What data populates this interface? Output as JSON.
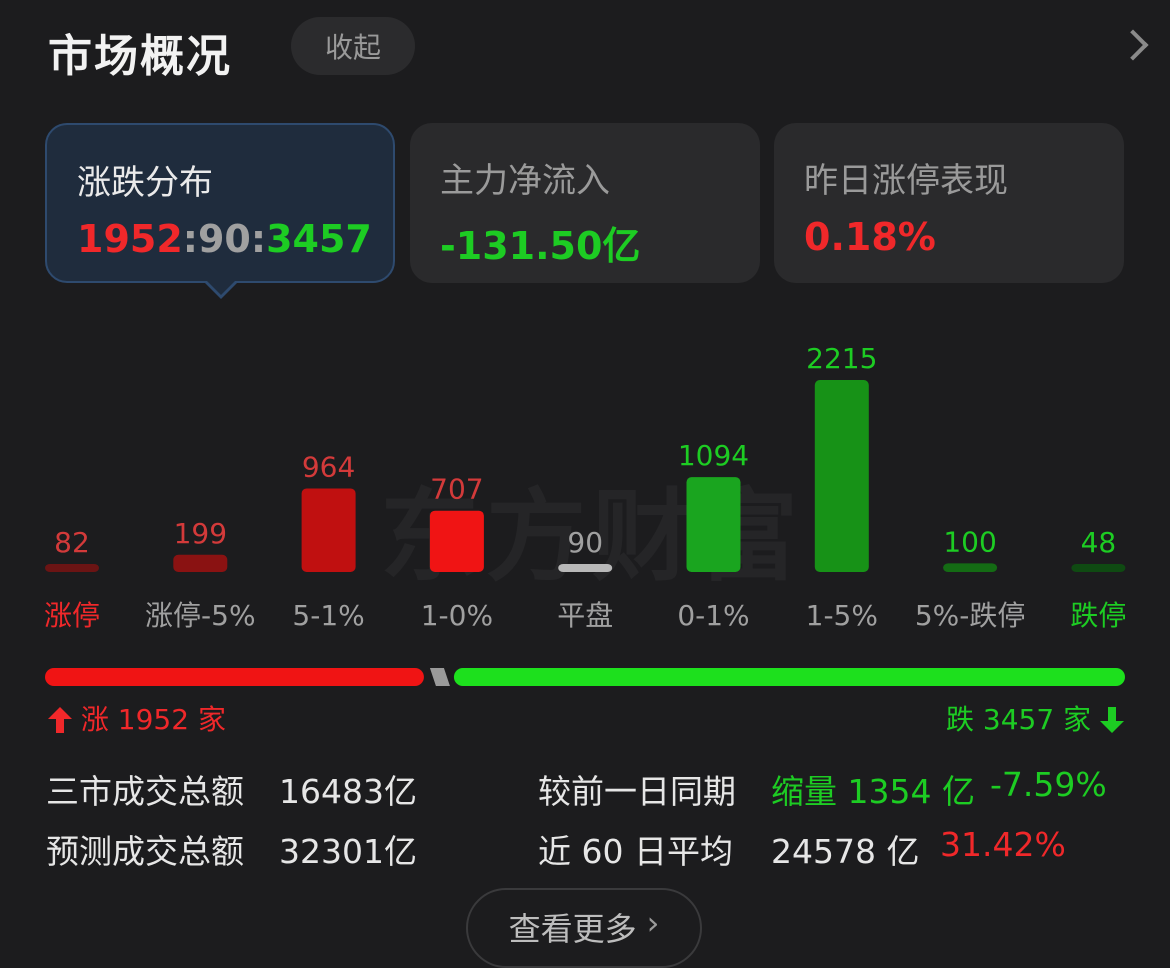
{
  "header": {
    "title": "市场概况",
    "collapse_label": "收起"
  },
  "cards": [
    {
      "label": "涨跌分布",
      "up": "1952",
      "flat": "90",
      "down": "3457"
    },
    {
      "label": "主力净流入",
      "value": "-131.50亿"
    },
    {
      "label": "昨日涨停表现",
      "value": "0.18%"
    }
  ],
  "watermark": "东方财富",
  "chart_data": {
    "type": "bar",
    "categories": [
      "涨停",
      "涨停-5%",
      "5-1%",
      "1-0%",
      "平盘",
      "0-1%",
      "1-5%",
      "5%-跌停",
      "跌停"
    ],
    "values": [
      82,
      199,
      964,
      707,
      90,
      1094,
      2215,
      100,
      48
    ],
    "colors": [
      "#6b1414",
      "#8a1212",
      "#c01010",
      "#f01414",
      "#b8b8b8",
      "#1aa51f",
      "#179217",
      "#146b14",
      "#0f4a12"
    ],
    "label_colors": [
      "#d33a3a",
      "#d33a3a",
      "#d33a3a",
      "#d33a3a",
      "#a0a0a0",
      "#1dcc23",
      "#1dcc23",
      "#1dcc23",
      "#1dcc23"
    ],
    "category_colors": [
      "#f0282a",
      "#a0a0a0",
      "#a0a0a0",
      "#a0a0a0",
      "#a0a0a0",
      "#a0a0a0",
      "#a0a0a0",
      "#a0a0a0",
      "#1dcc23"
    ]
  },
  "breadth": {
    "up_label": "涨 1952 家",
    "down_label": "跌 3457 家",
    "up_count": 1952,
    "down_count": 3457
  },
  "stats": {
    "row1": {
      "label": "三市成交总额",
      "value": "16483亿",
      "compare_label": "较前一日同期",
      "compare_value": "缩量 1354 亿",
      "compare_pct": "-7.59%"
    },
    "row2": {
      "label": "预测成交总额",
      "value": "32301亿",
      "avg_label": "近 60 日平均",
      "avg_value": "24578 亿",
      "avg_pct": "31.42%"
    }
  },
  "more_label": "查看更多"
}
